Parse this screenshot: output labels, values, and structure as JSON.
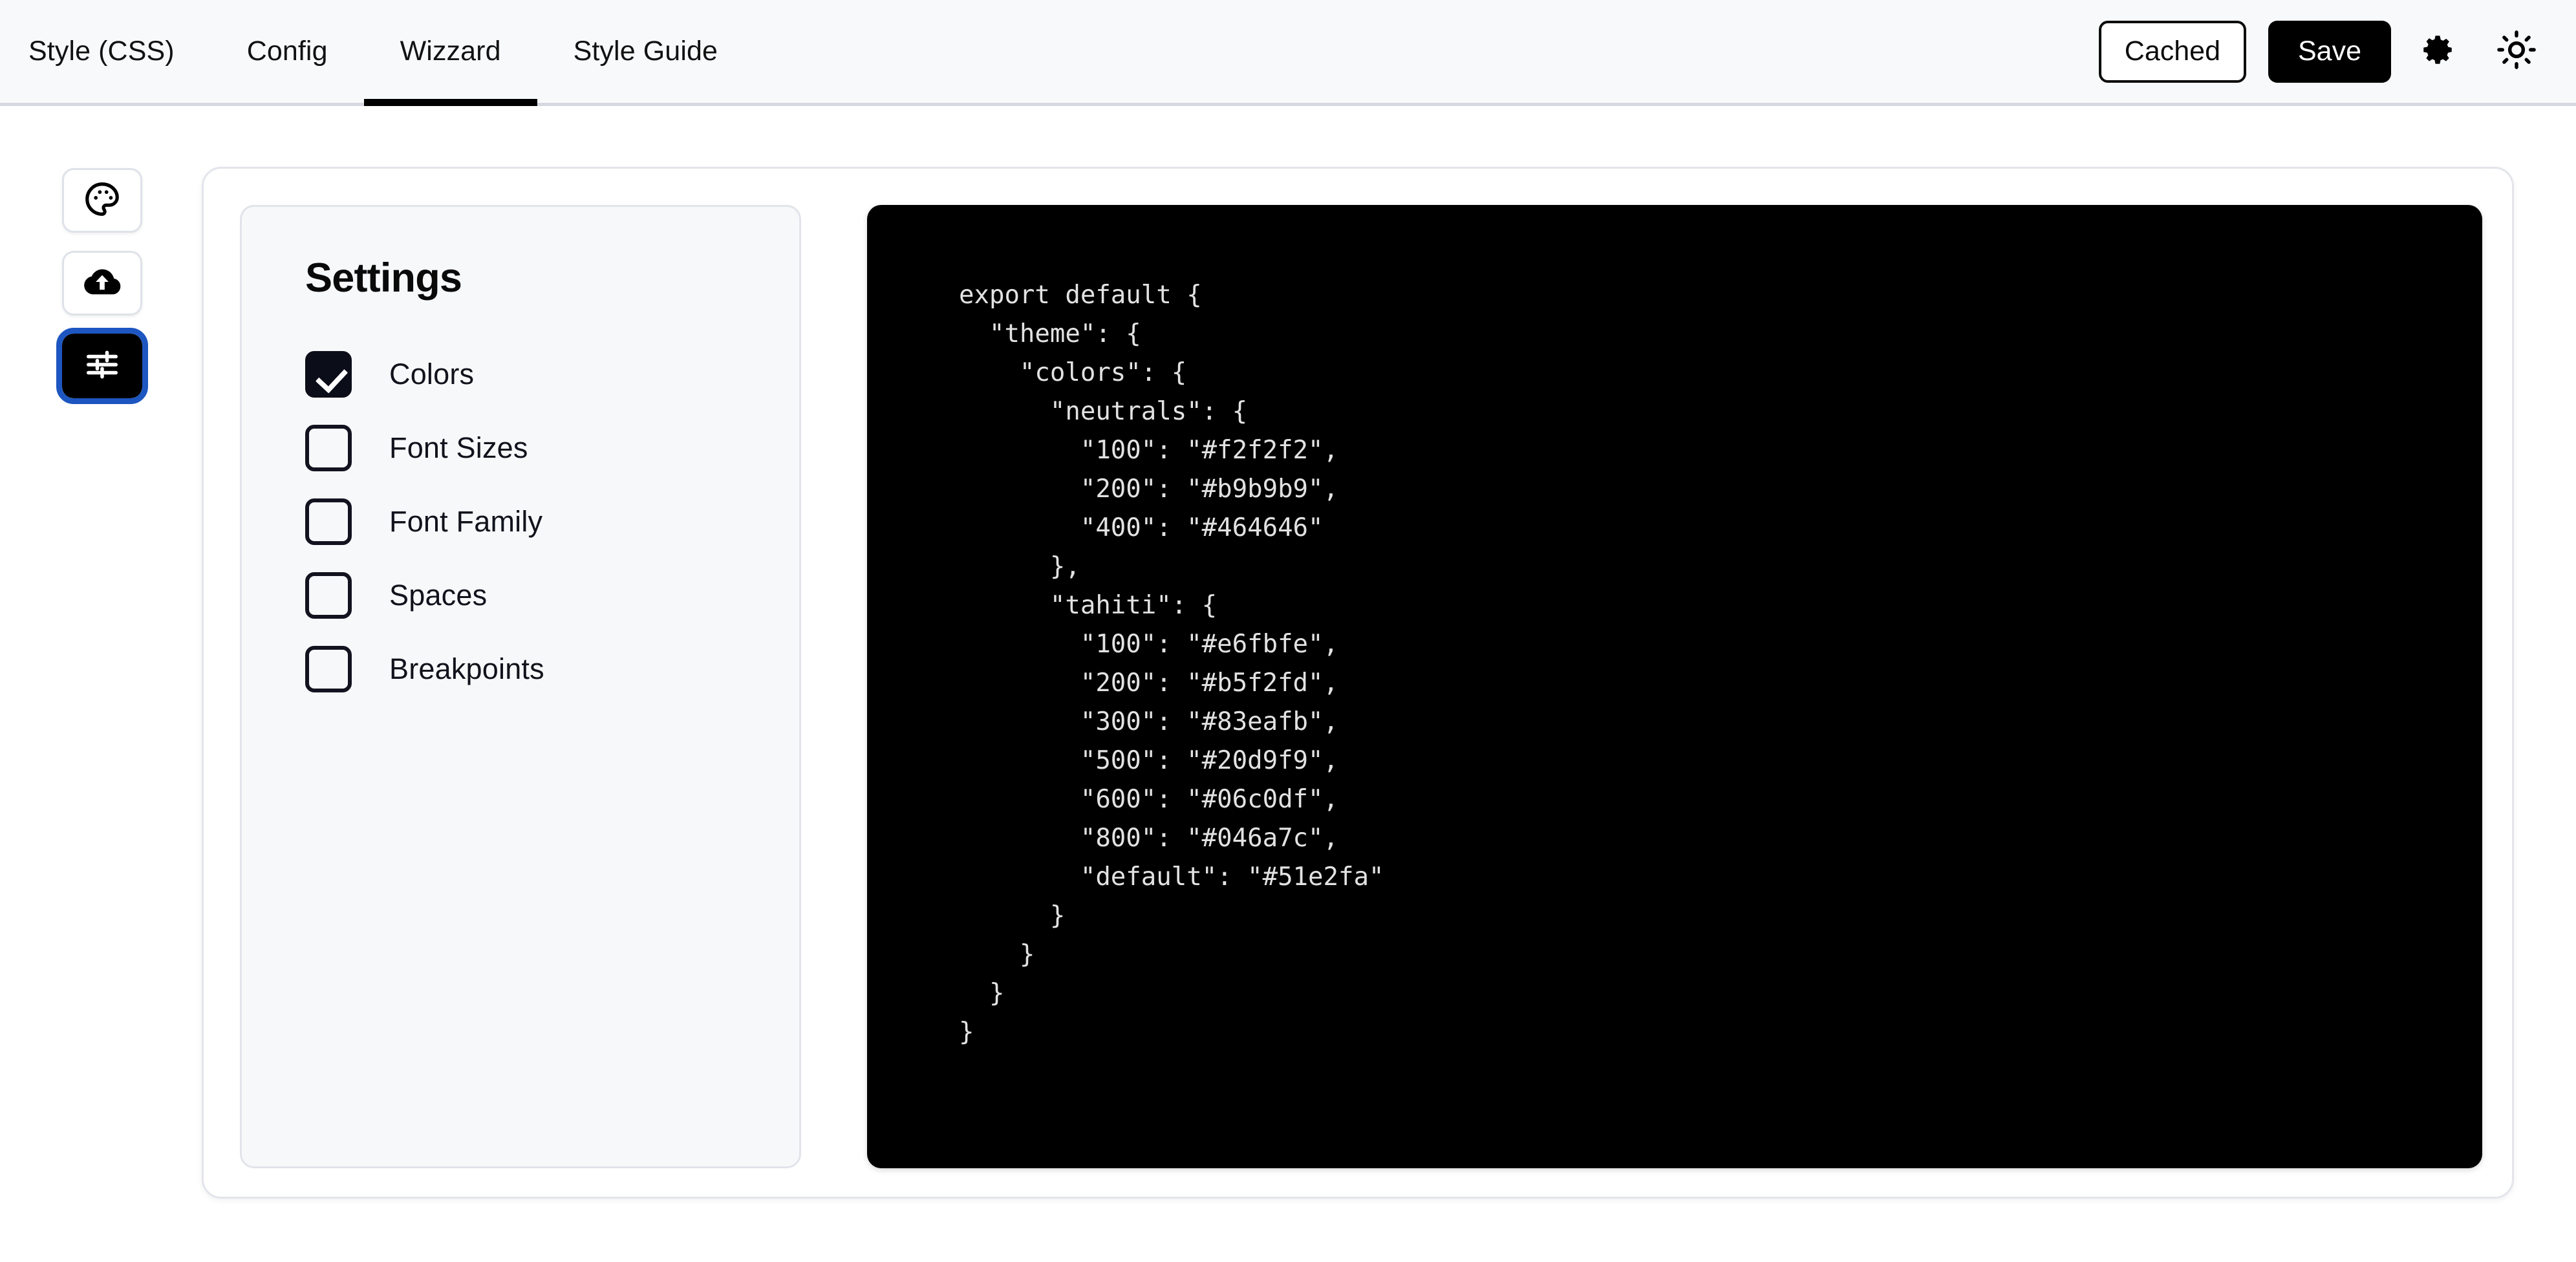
{
  "topbar": {
    "tabs": [
      {
        "label": "Style (CSS)",
        "active": false
      },
      {
        "label": "Config",
        "active": false
      },
      {
        "label": "Wizzard",
        "active": true
      },
      {
        "label": "Style Guide",
        "active": false
      }
    ],
    "cached_button": "Cached",
    "save_button": "Save",
    "settings_icon": "gear-icon",
    "theme_icon": "sun-brightness-icon",
    "background_color": "#f8f9fb",
    "border_color": "#d6d9e1",
    "active_tab_indicator_color": "#000000"
  },
  "rail": {
    "items": [
      {
        "icon": "palette-icon",
        "active": false
      },
      {
        "icon": "cloud-upload-icon",
        "active": false
      },
      {
        "icon": "sliders-tune-icon",
        "active": true
      }
    ],
    "active_background": "#000000",
    "focus_ring_color": "#1d56c0"
  },
  "settings": {
    "title": "Settings",
    "options": [
      {
        "label": "Colors",
        "checked": true
      },
      {
        "label": "Font Sizes",
        "checked": false
      },
      {
        "label": "Font Family",
        "checked": false
      },
      {
        "label": "Spaces",
        "checked": false
      },
      {
        "label": "Breakpoints",
        "checked": false
      }
    ],
    "panel_background": "#f7f8fa",
    "checkbox_checked_color": "#0b0d18"
  },
  "code": {
    "background_color": "#000000",
    "text_color": "#e2e2e2",
    "content": "export default {\n  \"theme\": {\n    \"colors\": {\n      \"neutrals\": {\n        \"100\": \"#f2f2f2\",\n        \"200\": \"#b9b9b9\",\n        \"400\": \"#464646\"\n      },\n      \"tahiti\": {\n        \"100\": \"#e6fbfe\",\n        \"200\": \"#b5f2fd\",\n        \"300\": \"#83eafb\",\n        \"500\": \"#20d9f9\",\n        \"600\": \"#06c0df\",\n        \"800\": \"#046a7c\",\n        \"default\": \"#51e2fa\"\n      }\n    }\n  }\n}",
    "theme": {
      "colors": {
        "neutrals": {
          "100": "#f2f2f2",
          "200": "#b9b9b9",
          "400": "#464646"
        },
        "tahiti": {
          "100": "#e6fbfe",
          "200": "#b5f2fd",
          "300": "#83eafb",
          "500": "#20d9f9",
          "600": "#06c0df",
          "800": "#046a7c",
          "default": "#51e2fa"
        }
      }
    }
  }
}
